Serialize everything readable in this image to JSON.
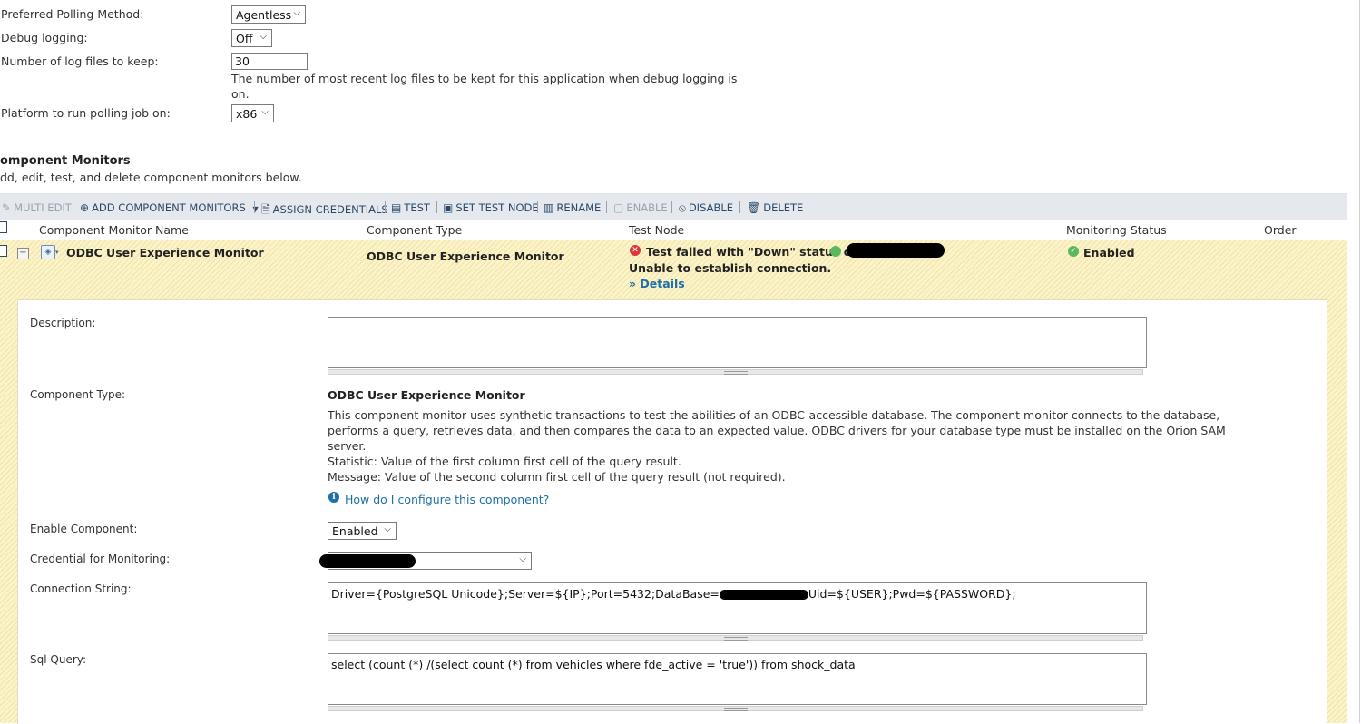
{
  "settings": {
    "polling_method_label": "Preferred Polling Method:",
    "polling_method_value": "Agentless",
    "debug_logging_label": "Debug logging:",
    "debug_logging_value": "Off",
    "log_files_label": "Number of log files to keep:",
    "log_files_value": "30",
    "log_files_help_line1": "The number of most recent log files to be kept for this application when debug logging is",
    "log_files_help_line2": "on.",
    "platform_label": "Platform to run polling job on:",
    "platform_value": "x86"
  },
  "section": {
    "title": "omponent Monitors",
    "subtitle": "dd, edit, test, and delete component monitors below."
  },
  "toolbar": {
    "multi_edit": "MULTI EDIT",
    "add_component_monitors": "ADD COMPONENT MONITORS",
    "assign_credentials": "ASSIGN CREDENTIALS",
    "test": "TEST",
    "set_test_node": "SET TEST NODE",
    "rename": "RENAME",
    "enable": "ENABLE",
    "disable": "DISABLE",
    "delete": "DELETE"
  },
  "table": {
    "columns": [
      "Component Monitor Name",
      "Component Type",
      "Test Node",
      "Monitoring Status",
      "Order"
    ],
    "row": {
      "name": "ODBC User Experience Monitor",
      "type": "ODBC User Experience Monitor",
      "test_status": "Test failed with \"Down\" status on",
      "test_message": "Unable to establish connection.",
      "details_link": "» Details",
      "monitoring_status": "Enabled"
    }
  },
  "details": {
    "description_label": "Description:",
    "description_value": "",
    "component_type_label": "Component Type:",
    "component_type_title": "ODBC User Experience Monitor",
    "component_type_desc_1": "This component monitor uses synthetic transactions to test the abilities of an ODBC-accessible database. The component monitor connects to the database,",
    "component_type_desc_2": "performs a query, retrieves data, and then compares the data to an expected value. ODBC drivers for your database type must be installed on the Orion SAM",
    "component_type_desc_3": "server.",
    "component_type_statistic": "Statistic: Value of the first column first cell of the query result.",
    "component_type_message": "Message: Value of the second column first cell of the query result (not required).",
    "help_link": "How do I configure this component?",
    "enable_component_label": "Enable Component:",
    "enable_component_value": "Enabled",
    "credential_label": "Credential for Monitoring:",
    "connection_string_label": "Connection String:",
    "connection_string_prefix": "Driver={PostgreSQL Unicode};Server=${IP};Port=5432;DataBase=",
    "connection_string_suffix": "Uid=${USER};Pwd=${PASSWORD};",
    "sql_query_label": "Sql Query:",
    "sql_query_value": "select (count (*) /(select count (*) from vehicles where fde_active = 'true')) from shock_data"
  },
  "colors": {
    "toolbar_bg": "#e5e8ec",
    "row_highlight": "#fbf3c9",
    "link": "#1f6fa8",
    "error_red": "#d9363e",
    "ok_green": "#5cb85c"
  }
}
